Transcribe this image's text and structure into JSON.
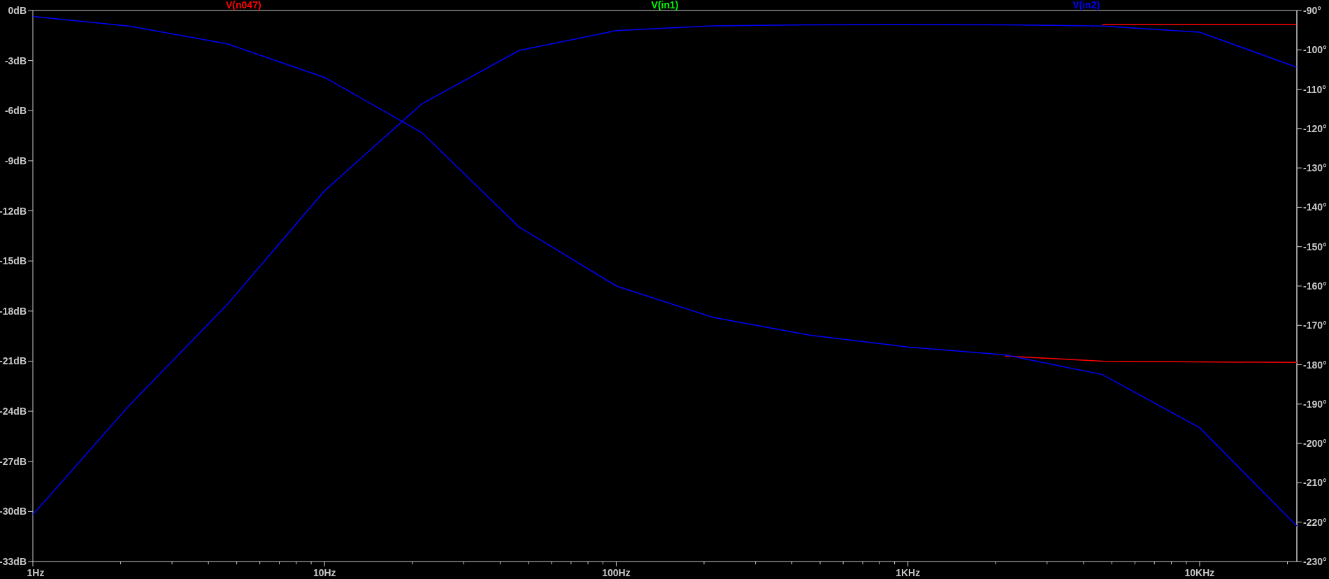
{
  "magnitude": {
    "chart_data": {
      "type": "line",
      "categories": [
        "1Hz",
        null,
        null,
        "10Hz",
        null,
        null,
        "100Hz",
        null,
        null,
        "1KHz",
        null,
        null,
        "10KHz",
        null
      ],
      "ylim": [
        -33,
        0
      ],
      "yticks": [
        {
          "value": 0,
          "label": "0dB"
        },
        {
          "value": -3,
          "label": "-3dB"
        },
        {
          "value": -6,
          "label": "-6dB"
        },
        {
          "value": -9,
          "label": "-9dB"
        },
        {
          "value": -12,
          "label": "-12dB"
        },
        {
          "value": -15,
          "label": "-15dB"
        },
        {
          "value": -18,
          "label": "-18dB"
        },
        {
          "value": -21,
          "label": "-21dB"
        },
        {
          "value": -24,
          "label": "-24dB"
        },
        {
          "value": -27,
          "label": "-27dB"
        },
        {
          "value": -30,
          "label": "-30dB"
        },
        {
          "value": -33,
          "label": "-33dB"
        }
      ],
      "series": [
        {
          "name": "V(n047)",
          "color": "#ff0000",
          "values": [
            null,
            null,
            null,
            null,
            null,
            null,
            null,
            null,
            null,
            null,
            null,
            -0.85,
            -0.85,
            -0.85
          ]
        },
        {
          "name": "V(in1)",
          "color": "#00ff00",
          "values": [
            null,
            null,
            null,
            null,
            null,
            null,
            null,
            null,
            null,
            null,
            null,
            null,
            null,
            null
          ]
        },
        {
          "name": "V(in2)",
          "color": "#0000ff",
          "values": [
            -30.2,
            -23.6,
            -17.6,
            -10.8,
            -5.6,
            -2.4,
            -1.2,
            -0.92,
            -0.86,
            -0.85,
            -0.86,
            -0.93,
            -1.3,
            -3.4
          ]
        }
      ]
    }
  },
  "phase": {
    "chart_data": {
      "type": "line",
      "categories": [
        null,
        null,
        null,
        null,
        null,
        null,
        null,
        null,
        null,
        null,
        null,
        null,
        null,
        null
      ],
      "ylim": [
        -230,
        -90
      ],
      "yticks": [
        {
          "value": -90,
          "label": "-90°"
        },
        {
          "value": -100,
          "label": "-100°"
        },
        {
          "value": -110,
          "label": "-110°"
        },
        {
          "value": -120,
          "label": "-120°"
        },
        {
          "value": -130,
          "label": "-130°"
        },
        {
          "value": -140,
          "label": "-140°"
        },
        {
          "value": -150,
          "label": "-150°"
        },
        {
          "value": -160,
          "label": "-160°"
        },
        {
          "value": -170,
          "label": "-170°"
        },
        {
          "value": -180,
          "label": "-180°"
        },
        {
          "value": -190,
          "label": "-190°"
        },
        {
          "value": -200,
          "label": "-200°"
        },
        {
          "value": -210,
          "label": "-210°"
        },
        {
          "value": -220,
          "label": "-220°"
        },
        {
          "value": -230,
          "label": "-230°"
        }
      ],
      "series": [
        {
          "color": "#ff0000",
          "values": [
            null,
            null,
            null,
            null,
            null,
            null,
            null,
            null,
            null,
            null,
            -177.8,
            -179.1,
            -179.3,
            -179.4
          ]
        },
        {
          "color": "#00ff00",
          "values": [
            null,
            null,
            null,
            null,
            null,
            null,
            null,
            null,
            null,
            null,
            null,
            null,
            null,
            null
          ]
        },
        {
          "color": "#0000ff",
          "values": [
            -91.5,
            -94,
            -98.5,
            -107,
            -121,
            -145,
            -160,
            -168,
            -172.5,
            -175.5,
            -177.5,
            -182.5,
            -196,
            -221
          ]
        }
      ]
    }
  }
}
